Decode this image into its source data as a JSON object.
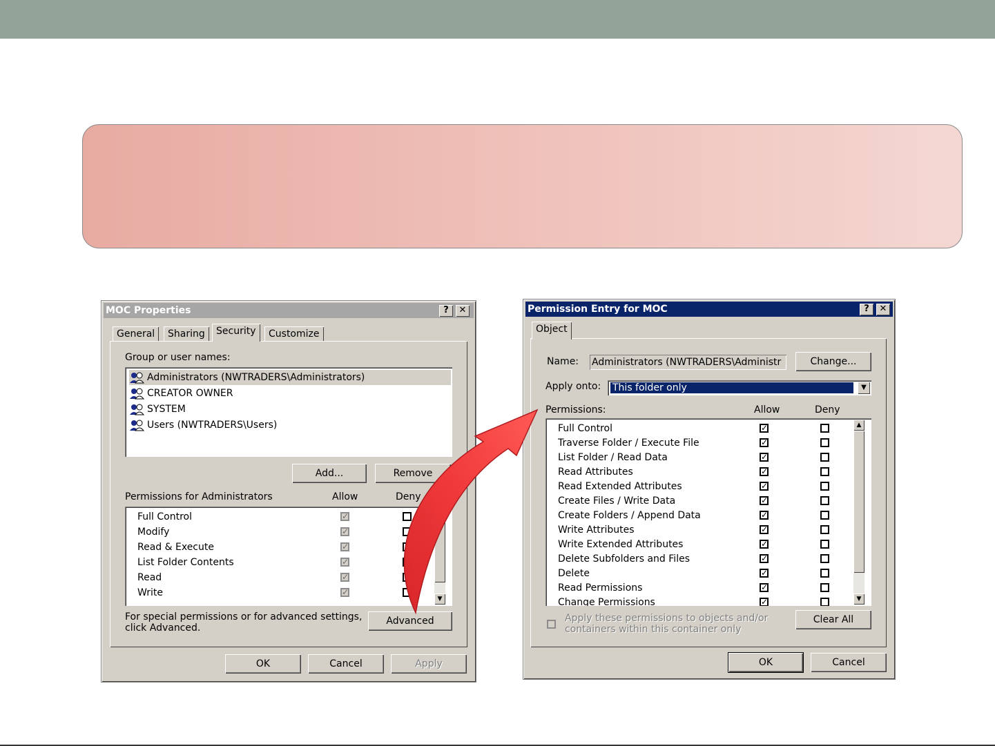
{
  "colors": {
    "topbar": "#93a39a",
    "banner_start": "#e8aba2",
    "banner_end": "#f4d7d2",
    "arrow": "#f0393b",
    "active_title": "#0a246a",
    "inactive_title": "#a6a6a6"
  },
  "moc_properties": {
    "title": "MOC Properties",
    "help_btn": "?",
    "close_btn": "✕",
    "tabs": [
      "General",
      "Sharing",
      "Security",
      "Customize"
    ],
    "group_label": "Group or user names:",
    "users": [
      "Administrators (NWTRADERS\\Administrators)",
      "CREATOR OWNER",
      "SYSTEM",
      "Users (NWTRADERS\\Users)"
    ],
    "add_btn": "Add...",
    "remove_btn": "Remove",
    "permissions_label": "Permissions for Administrators",
    "allow_header": "Allow",
    "deny_header": "Deny",
    "permissions": [
      "Full Control",
      "Modify",
      "Read & Execute",
      "List Folder Contents",
      "Read",
      "Write"
    ],
    "advanced_note_line1": "For special permissions or for advanced settings,",
    "advanced_note_line2": "click Advanced.",
    "advanced_btn": "Advanced",
    "ok_btn": "OK",
    "cancel_btn": "Cancel",
    "apply_btn": "Apply"
  },
  "permission_entry": {
    "title": "Permission Entry for MOC",
    "help_btn": "?",
    "close_btn": "✕",
    "tab": "Object",
    "name_label": "Name:",
    "name_value": "Administrators (NWTRADERS\\Administr",
    "change_btn": "Change...",
    "apply_onto_label": "Apply onto:",
    "apply_onto_value": "This folder only",
    "permissions_label": "Permissions:",
    "allow_header": "Allow",
    "deny_header": "Deny",
    "permissions": [
      "Full Control",
      "Traverse Folder / Execute File",
      "List Folder / Read Data",
      "Read Attributes",
      "Read Extended Attributes",
      "Create Files / Write Data",
      "Create Folders / Append Data",
      "Write Attributes",
      "Write Extended Attributes",
      "Delete Subfolders and Files",
      "Delete",
      "Read Permissions",
      "Change Permissions"
    ],
    "apply_note_line1": "Apply these permissions to objects and/or",
    "apply_note_line2": "containers within this container only",
    "clear_all_btn": "Clear All",
    "ok_btn": "OK",
    "cancel_btn": "Cancel"
  }
}
